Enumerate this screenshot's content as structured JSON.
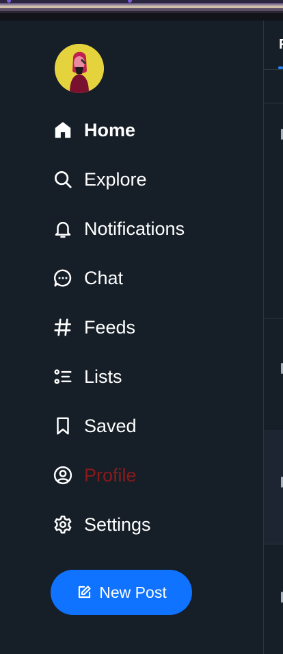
{
  "nav": {
    "items": [
      {
        "label": "Home",
        "icon": "home-icon",
        "bold": true
      },
      {
        "label": "Explore",
        "icon": "search-icon"
      },
      {
        "label": "Notifications",
        "icon": "bell-icon"
      },
      {
        "label": "Chat",
        "icon": "chat-bubble-icon"
      },
      {
        "label": "Feeds",
        "icon": "hash-icon"
      },
      {
        "label": "Lists",
        "icon": "list-icon"
      },
      {
        "label": "Saved",
        "icon": "bookmark-icon"
      },
      {
        "label": "Profile",
        "icon": "person-circle-icon"
      },
      {
        "label": "Settings",
        "icon": "gear-icon"
      }
    ]
  },
  "new_post": {
    "label": "New Post",
    "icon": "compose-icon"
  },
  "right_tab": {
    "label": "F"
  },
  "colors": {
    "background": "#161e27",
    "accent": "#0f73ff",
    "profile_label": "#8b1a1a",
    "text": "#ffffff"
  }
}
